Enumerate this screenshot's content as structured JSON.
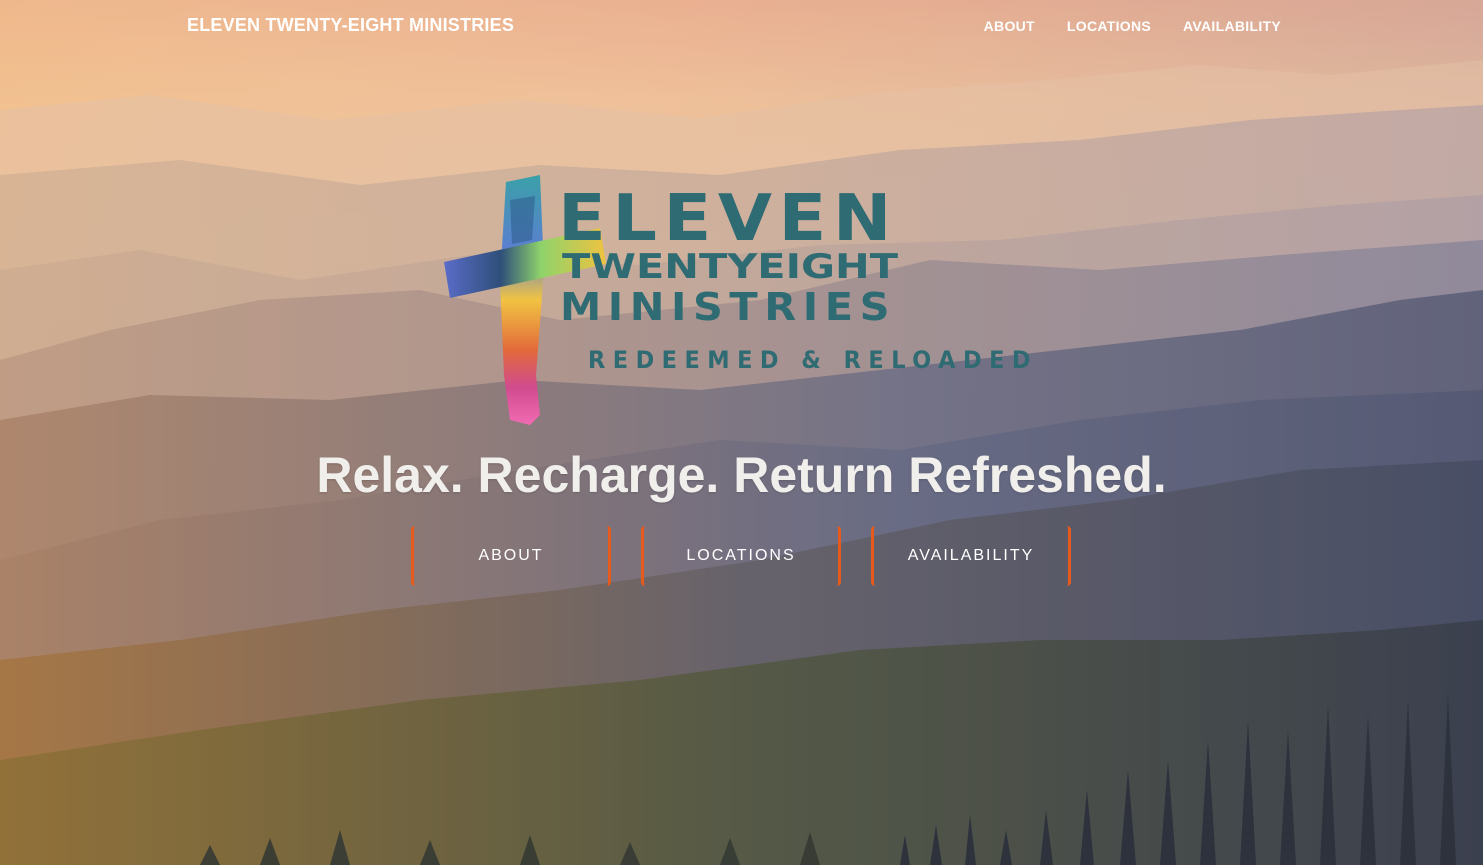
{
  "navbar": {
    "brand": "ELEVEN TWENTY-EIGHT MINISTRIES",
    "links": [
      "ABOUT",
      "LOCATIONS",
      "AVAILABILITY"
    ]
  },
  "logo": {
    "line1": "ELEVEN",
    "line2": "TWENTYEIGHT",
    "line3": "MINISTRIES",
    "line4": "REDEEMED & RELOADED"
  },
  "hero": {
    "tagline": "Relax. Recharge. Return Refreshed.",
    "buttons": [
      "ABOUT",
      "LOCATIONS",
      "AVAILABILITY"
    ]
  },
  "colors": {
    "accent": "#e85a1b",
    "logo_teal": "#2f6b73",
    "text_light": "#f1efec"
  },
  "icons": {
    "logo_mark": "cross-icon"
  }
}
